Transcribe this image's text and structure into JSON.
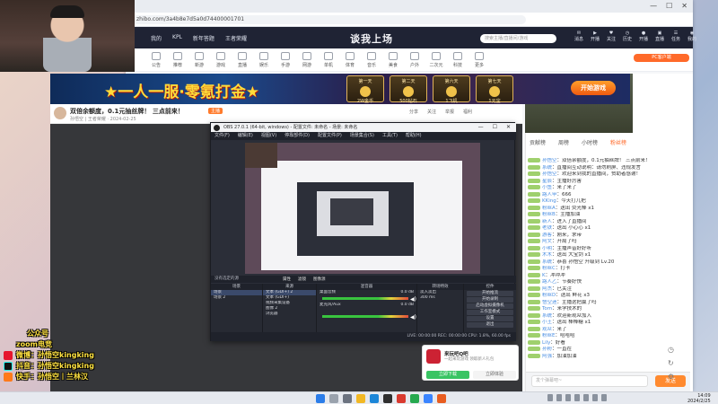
{
  "browser": {
    "url": "zhibo.com/3a4b8e7d5a0d74400001701",
    "controls": [
      "—",
      "☐",
      "✕"
    ]
  },
  "site": {
    "nav": [
      "我的",
      "KPL",
      "新年答题",
      "王者荣耀"
    ],
    "logo": "谈我上场",
    "search_placeholder": "搜索主播/直播间/游戏",
    "icons": [
      "消息",
      "开播",
      "关注",
      "历史",
      "开播",
      "直播",
      "任务",
      "我的"
    ],
    "categories": [
      "公告",
      "推荐",
      "新游",
      "游戏",
      "直播",
      "娱乐",
      "手游",
      "网游",
      "单机",
      "体育",
      "音乐",
      "美食",
      "户外",
      "二次元",
      "科技",
      "更多"
    ]
  },
  "banner": {
    "title": "★一人一服·零氪打金★",
    "days": [
      {
        "label": "第一天",
        "value": "2W金币"
      },
      {
        "label": "第二天",
        "value": "500钻石"
      },
      {
        "label": "第六天",
        "value": "1飞机"
      },
      {
        "label": "第七天",
        "value": "1元宝"
      }
    ],
    "start": "开始游戏",
    "pc_badge": "PC客户端"
  },
  "room": {
    "title": "双倍余额度，0.1元抽丝牌！ 三点前来！",
    "meta": "孙悟空 | 王者荣耀 · 2024-02-25",
    "tag": "主播",
    "actions": [
      "分享",
      "关注",
      "举报",
      "福利"
    ]
  },
  "rank_tabs": [
    "贡献榜",
    "周榜",
    "小时榜",
    "粉丝榜"
  ],
  "chat": [
    {
      "user": "孙悟空",
      "text": "双倍余额度，0.1元抽丝牌！ 三点前来！"
    },
    {
      "user": "系统",
      "text": "直播间互动说明：请勿刷屏、违规发言"
    },
    {
      "user": "孙悟空",
      "text": "欢迎来到我的直播间，赞助者感谢！"
    },
    {
      "user": "星辰",
      "text": "主播好厉害"
    },
    {
      "user": "小鱼",
      "text": "来了来了"
    },
    {
      "user": "路人甲",
      "text": "666"
    },
    {
      "user": "KKing",
      "text": "今天打几把"
    },
    {
      "user": "粉丝A",
      "text": "送出 荧光棒 x1"
    },
    {
      "user": "粉丝B",
      "text": "主播加油"
    },
    {
      "user": "新人",
      "text": "进入了直播间"
    },
    {
      "user": "老铁",
      "text": "送出 小心心 x1"
    },
    {
      "user": "游客",
      "text": "刚来，求带"
    },
    {
      "user": "阿文",
      "text": "开局了吗"
    },
    {
      "user": "小明",
      "text": "主播声音好好听"
    },
    {
      "user": "木木",
      "text": "送出 大宝剑 x1"
    },
    {
      "user": "系统",
      "text": "恭喜 孙悟空 升级到 Lv.20"
    },
    {
      "user": "粉丝C",
      "text": "打卡"
    },
    {
      "user": "K",
      "text": "冲冲冲"
    },
    {
      "user": "路人乙",
      "text": "节奏好快"
    },
    {
      "user": "阿杰",
      "text": "已关注"
    },
    {
      "user": "粉丝D",
      "text": "送出 鲜花 x3"
    },
    {
      "user": "悟空迷",
      "text": "主播这把赢了吗"
    },
    {
      "user": "Tom",
      "text": "来学技术的"
    },
    {
      "user": "系统",
      "text": "欢迎新观众加入"
    },
    {
      "user": "小王",
      "text": "送出 棒棒糖 x1"
    },
    {
      "user": "观众",
      "text": "来了"
    },
    {
      "user": "粉丝E",
      "text": "哈哈哈"
    },
    {
      "user": "Lily",
      "text": "好看"
    },
    {
      "user": "孙粉",
      "text": "一直在"
    },
    {
      "user": "阿强",
      "text": "加油加油"
    }
  ],
  "chat_input": {
    "placeholder": "发个弹幕吧~",
    "send": "发送"
  },
  "obs": {
    "title": "OBS 27.0.1 (64-bit, windows) - 配置文件: 未命名 - 场景: 未命名",
    "menu": [
      "文件(F)",
      "编辑(E)",
      "视图(V)",
      "停靠部件(D)",
      "配置文件(P)",
      "场景集合(S)",
      "工具(T)",
      "帮助(H)"
    ],
    "controls": [
      "—",
      "☐",
      "✕"
    ],
    "src_toolbar": [
      "属性",
      "滤镜",
      "图像源"
    ],
    "status_line": "没有选定的源",
    "docks": {
      "scenes_head": "场景",
      "scenes": [
        "场景",
        "场景 2"
      ],
      "sources_head": "来源",
      "sources": [
        "文本 (GDI+) 2",
        "文本 (GDI+)",
        "视频采集设备",
        "图像 2",
        "浏览器"
      ],
      "mixer_head": "混音器",
      "mixer": [
        "桌面音频",
        "麦克风/Aux"
      ],
      "mixer_db": [
        "0.0 dB",
        "0.0 dB"
      ],
      "transitions_head": "转场特效",
      "transition": "淡入淡出",
      "duration": "300 ms",
      "controls_head": "控件",
      "controls": [
        "开始推流",
        "开始录制",
        "启动虚拟摄像机",
        "工作室模式",
        "设置",
        "退出"
      ]
    },
    "status_bar": "LIVE: 00:00:00   REC: 00:00:00   CPU: 1.8%, 60.00 fps"
  },
  "promo": {
    "name": "来玩吧Q吧",
    "desc": "一起来玩游戏 领取新人礼包",
    "btn1": "立即下载",
    "btn2": "立即体验"
  },
  "overlay": {
    "head": "公众号",
    "subhead": "zoom电竞",
    "lines": [
      {
        "platform": "weibo",
        "text": "微博：孙悟空kingking"
      },
      {
        "platform": "douyin",
        "text": "抖音：孙悟空kingking"
      },
      {
        "platform": "kuaishou",
        "text": "快手：孙悟空丨兰林汉"
      }
    ]
  },
  "clock": {
    "time": "14:09",
    "date": "2024/2/25"
  },
  "colors": {
    "accent": "#ff6a2a",
    "overlay_text": "#ffe240",
    "obs_bg": "#2b2e38"
  }
}
